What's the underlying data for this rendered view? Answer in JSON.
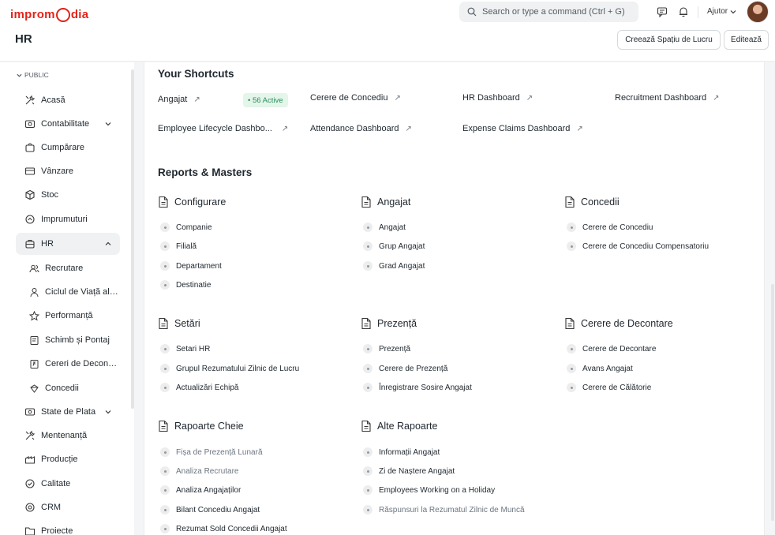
{
  "brand": {
    "logo_text_1": "impro",
    "logo_text_2": "dia"
  },
  "navbar": {
    "search_placeholder": "Search or type a command (Ctrl + G)",
    "help_label": "Ajutor"
  },
  "page": {
    "title": "HR",
    "create_workspace_label": "Creează Spațiu de Lucru",
    "edit_label": "Editează"
  },
  "sidebar": {
    "section": "PUBLIC",
    "items": [
      {
        "label": "Acasă",
        "icon": "tools-icon"
      },
      {
        "label": "Contabilitate",
        "icon": "accounting-icon",
        "expandable": true
      },
      {
        "label": "Cumpărare",
        "icon": "cart-icon"
      },
      {
        "label": "Vânzare",
        "icon": "sell-icon"
      },
      {
        "label": "Stoc",
        "icon": "box-icon"
      },
      {
        "label": "Imprumuturi",
        "icon": "loan-icon"
      },
      {
        "label": "HR",
        "icon": "hr-icon",
        "expanded": true
      }
    ],
    "hr_children": [
      {
        "label": "Recrutare",
        "icon": "users-icon"
      },
      {
        "label": "Ciclul de Viață al Angajatului",
        "icon": "user-icon"
      },
      {
        "label": "Performanță",
        "icon": "star-icon"
      },
      {
        "label": "Schimb și Pontaj",
        "icon": "shift-icon"
      },
      {
        "label": "Cereri de Decontare",
        "icon": "expense-icon"
      },
      {
        "label": "Concedii",
        "icon": "leave-icon"
      }
    ],
    "items_after": [
      {
        "label": "State de Plata",
        "icon": "payroll-icon",
        "expandable": true
      },
      {
        "label": "Mentenanță",
        "icon": "tools-icon"
      },
      {
        "label": "Producție",
        "icon": "factory-icon"
      },
      {
        "label": "Calitate",
        "icon": "quality-icon"
      },
      {
        "label": "CRM",
        "icon": "crm-icon"
      },
      {
        "label": "Proiecte",
        "icon": "folder-icon"
      }
    ]
  },
  "shortcuts": {
    "title": "Your Shortcuts",
    "items": [
      {
        "label": "Angajat",
        "badge": "• 56 Active"
      },
      {
        "label": "Cerere de Concediu"
      },
      {
        "label": "HR Dashboard"
      },
      {
        "label": "Recruitment Dashboard"
      },
      {
        "label": "Employee Lifecycle Dashbo..."
      },
      {
        "label": "Attendance Dashboard"
      },
      {
        "label": "Expense Claims Dashboard"
      }
    ]
  },
  "reports": {
    "title": "Reports & Masters",
    "cards": [
      {
        "title": "Configurare",
        "links": [
          "Companie",
          "Filială",
          "Departament",
          "Destinatie"
        ]
      },
      {
        "title": "Angajat",
        "links": [
          "Angajat",
          "Grup Angajat",
          "Grad Angajat"
        ]
      },
      {
        "title": "Concedii",
        "links": [
          "Cerere de Concediu",
          "Cerere de Concediu Compensatoriu"
        ]
      },
      {
        "title": "Setări",
        "links": [
          "Setari HR",
          "Grupul Rezumatului Zilnic de Lucru",
          "Actualizări Echipă"
        ]
      },
      {
        "title": "Prezență",
        "links": [
          "Prezență",
          "Cerere de Prezență",
          "Înregistrare Sosire Angajat"
        ]
      },
      {
        "title": "Cerere de Decontare",
        "links": [
          "Cerere de Decontare",
          "Avans Angajat",
          "Cerere de Călătorie"
        ]
      },
      {
        "title": "Rapoarte Cheie",
        "links": [
          "Fișa de Prezență Lunară",
          "Analiza Recrutare",
          "Analiza Angajaților",
          "Bilant Concediu Angajat",
          "Rezumat Sold Concedii Angajat"
        ]
      },
      {
        "title": "Alte Rapoarte",
        "links": [
          "Informații Angajat",
          "Zi de Naștere Angajat",
          "Employees Working on a Holiday",
          "Răspunsuri la Rezumatul Zilnic de Muncă"
        ]
      }
    ]
  }
}
